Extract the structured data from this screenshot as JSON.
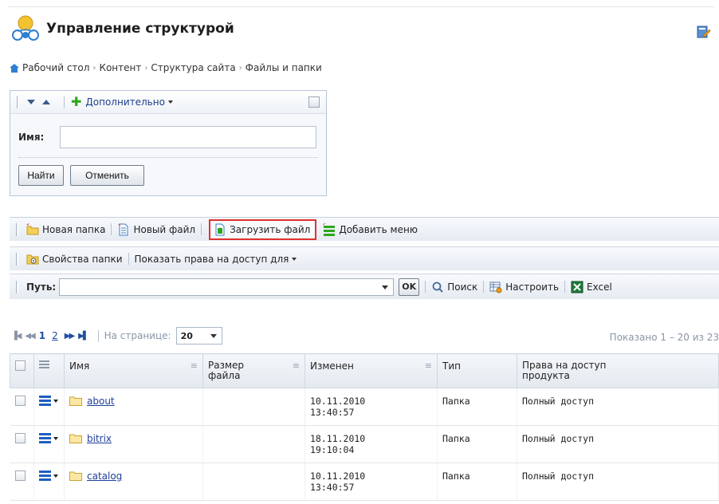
{
  "header": {
    "title": "Управление структурой"
  },
  "breadcrumb": [
    "Рабочий стол",
    "Контент",
    "Структура сайта",
    "Файлы и папки"
  ],
  "filter": {
    "more_label": "Дополнительно",
    "name_label": "Имя:",
    "name_value": "",
    "find_button": "Найти",
    "cancel_button": "Отменить"
  },
  "toolbar": {
    "new_folder": "Новая папка",
    "new_file": "Новый файл",
    "upload_file": "Загрузить файл",
    "add_menu": "Добавить меню",
    "folder_props": "Свойства папки",
    "show_rights": "Показать права на доступ для",
    "path_label": "Путь:",
    "path_value": "",
    "ok": "OK",
    "search": "Поиск",
    "settings": "Настроить",
    "excel": "Excel"
  },
  "pager": {
    "pages": [
      "1",
      "2"
    ],
    "current_page": "1",
    "per_page_label": "На странице:",
    "per_page_value": "20",
    "shown_text": "Показано 1 – 20 из 23"
  },
  "table": {
    "columns": [
      "Имя",
      "Размер файла",
      "Изменен",
      "Тип",
      "Права на доступ продукта"
    ],
    "rows": [
      {
        "name": "about",
        "size": "",
        "modified_date": "10.11.2010",
        "modified_time": "13:40:57",
        "type": "Папка",
        "rights": "Полный доступ"
      },
      {
        "name": "bitrix",
        "size": "",
        "modified_date": "18.11.2010",
        "modified_time": "19:10:04",
        "type": "Папка",
        "rights": "Полный доступ"
      },
      {
        "name": "catalog",
        "size": "",
        "modified_date": "10.11.2010",
        "modified_time": "13:40:57",
        "type": "Папка",
        "rights": "Полный доступ"
      }
    ]
  },
  "colors": {
    "highlight_border": "#e03131",
    "link": "#1f3f9a",
    "accent": "#1c5fc2"
  }
}
